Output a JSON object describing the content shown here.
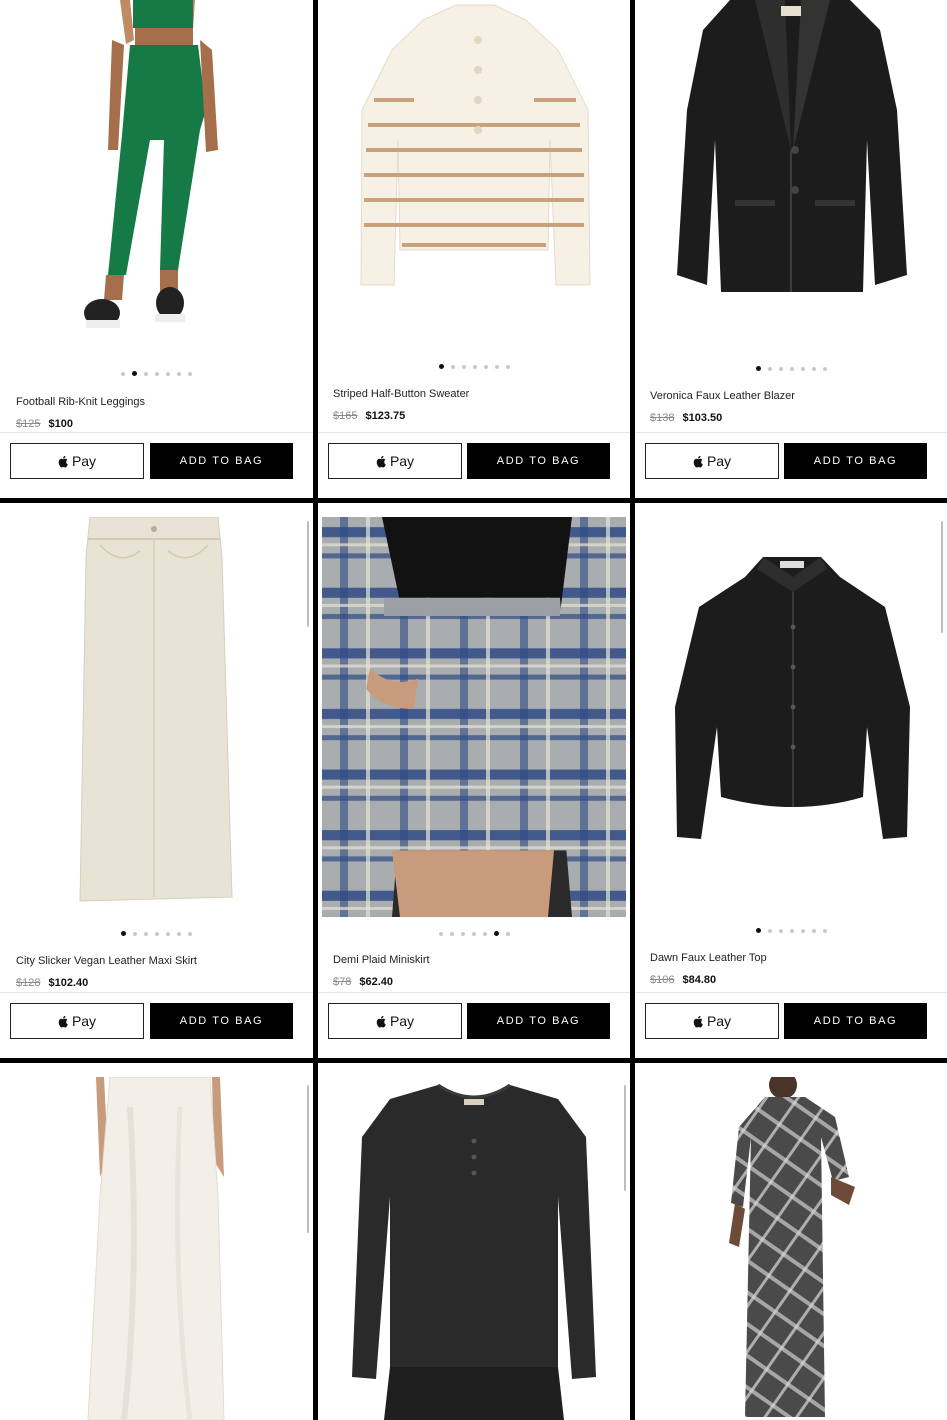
{
  "buttons": {
    "apple_pay_label": "Pay",
    "add_to_bag_label": "ADD TO BAG"
  },
  "products": [
    {
      "name": "Football Rib-Knit Leggings",
      "was": "$125",
      "price": "$100",
      "dots": 7,
      "active_dot": 1
    },
    {
      "name": "Striped Half-Button Sweater",
      "was": "$165",
      "price": "$123.75",
      "dots": 7,
      "active_dot": 0
    },
    {
      "name": "Veronica Faux Leather Blazer",
      "was": "$138",
      "price": "$103.50",
      "dots": 7,
      "active_dot": 0
    },
    {
      "name": "City Slicker Vegan Leather Maxi Skirt",
      "was": "$128",
      "price": "$102.40",
      "dots": 7,
      "active_dot": 0
    },
    {
      "name": "Demi Plaid Miniskirt",
      "was": "$78",
      "price": "$62.40",
      "dots": 7,
      "active_dot": 5
    },
    {
      "name": "Dawn Faux Leather Top",
      "was": "$106",
      "price": "$84.80",
      "dots": 7,
      "active_dot": 0
    },
    {
      "name": "",
      "was": "",
      "price": ""
    },
    {
      "name": "",
      "was": "",
      "price": ""
    },
    {
      "name": "",
      "was": "",
      "price": ""
    }
  ],
  "colors": {
    "leggings_green": "#157a45",
    "sweater_cream": "#f6f1e4",
    "sweater_stripe": "#c9a27d",
    "leather_black": "#1c1c1c",
    "skirt_cream": "#e9e3d6",
    "plaid_blue": "#2f4a85",
    "plaid_gray": "#a9adb0",
    "satin_white": "#f2efe9",
    "henley_black": "#2a2a2a"
  }
}
